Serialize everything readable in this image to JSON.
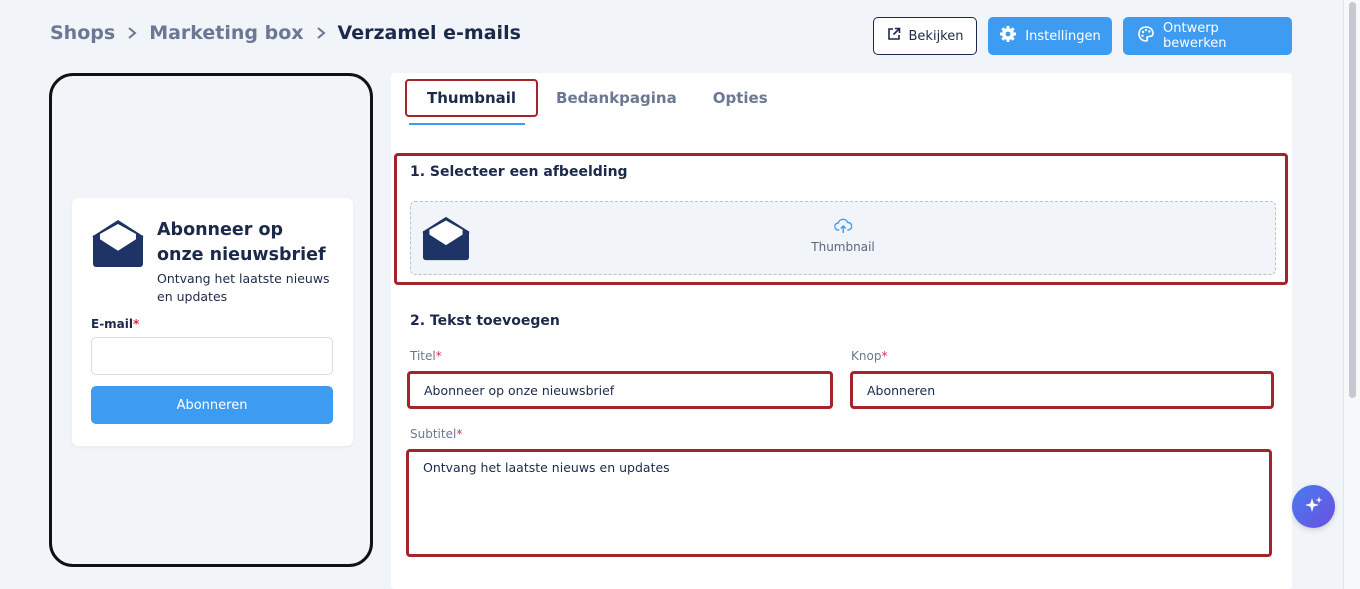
{
  "breadcrumb": {
    "items": [
      "Shops",
      "Marketing box"
    ],
    "current": "Verzamel e-mails"
  },
  "actions": {
    "view": "Bekijken",
    "settings": "Instellingen",
    "design": "Ontwerp bewerken"
  },
  "preview": {
    "title": "Abonneer op onze nieuwsbrief",
    "subtitle": "Ontvang het laatste nieuws en updates",
    "email_label": "E-mail",
    "required_mark": "*",
    "button": "Abonneren"
  },
  "tabs": [
    "Thumbnail",
    "Bedankpagina",
    "Opties"
  ],
  "section1": {
    "title": "1. Selecteer een afbeelding",
    "upload_label": "Thumbnail"
  },
  "section2": {
    "title": "2. Tekst toevoegen",
    "title_label": "Titel",
    "title_value": "Abonneer op onze nieuwsbrief",
    "button_label": "Knop",
    "button_value": "Abonneren",
    "subtitle_label": "Subtitel",
    "subtitle_value": "Ontvang het laatste nieuws en updates"
  },
  "colors": {
    "primary": "#3d9cf2",
    "navy": "#1b2a4a",
    "highlight": "#a2252b"
  }
}
